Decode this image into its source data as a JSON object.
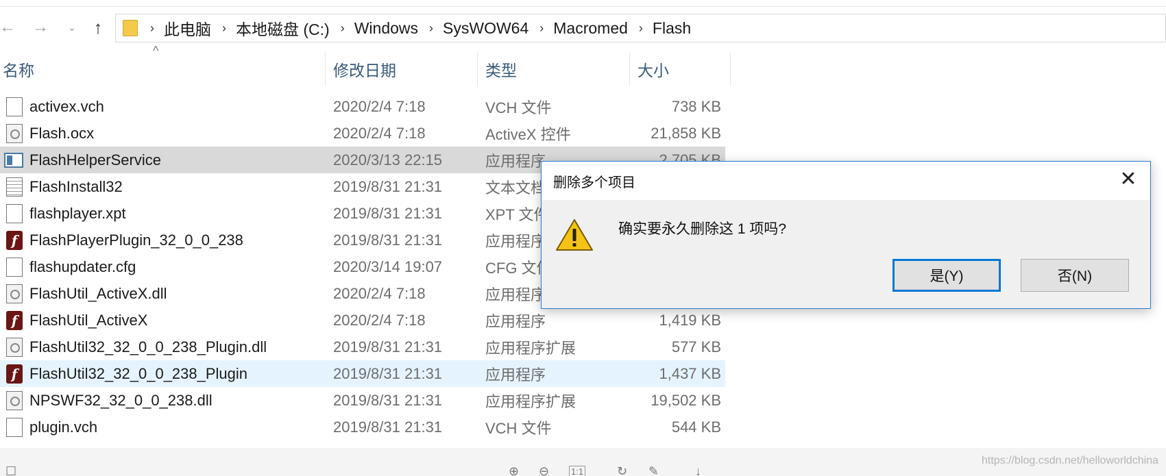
{
  "address_bar": {
    "crumbs": [
      "此电脑",
      "本地磁盘 (C:)",
      "Windows",
      "SysWOW64",
      "Macromed",
      "Flash"
    ]
  },
  "columns": {
    "name": "名称",
    "date": "修改日期",
    "type": "类型",
    "size": "大小"
  },
  "files": [
    {
      "name": "activex.vch",
      "date": "2020/2/4 7:18",
      "type": "VCH 文件",
      "size": "738 KB",
      "icon": "document-icon"
    },
    {
      "name": "Flash.ocx",
      "date": "2020/2/4 7:18",
      "type": "ActiveX 控件",
      "size": "21,858 KB",
      "icon": "activex-icon"
    },
    {
      "name": "FlashHelperService",
      "date": "2020/3/13 22:15",
      "type": "应用程序",
      "size": "2,705 KB",
      "icon": "service-icon"
    },
    {
      "name": "FlashInstall32",
      "date": "2019/8/31 21:31",
      "type": "文本文档",
      "size": "",
      "icon": "text-file-icon"
    },
    {
      "name": "flashplayer.xpt",
      "date": "2019/8/31 21:31",
      "type": "XPT 文件",
      "size": "",
      "icon": "document-icon"
    },
    {
      "name": "FlashPlayerPlugin_32_0_0_238",
      "date": "2019/8/31 21:31",
      "type": "应用程序",
      "size": "",
      "icon": "flash-icon"
    },
    {
      "name": "flashupdater.cfg",
      "date": "2020/3/14 19:07",
      "type": "CFG 文件",
      "size": "",
      "icon": "document-icon"
    },
    {
      "name": "FlashUtil_ActiveX.dll",
      "date": "2020/2/4 7:18",
      "type": "应用程序",
      "size": "",
      "icon": "dll-icon"
    },
    {
      "name": "FlashUtil_ActiveX",
      "date": "2020/2/4 7:18",
      "type": "应用程序",
      "size": "1,419 KB",
      "icon": "flash-icon"
    },
    {
      "name": "FlashUtil32_32_0_0_238_Plugin.dll",
      "date": "2019/8/31 21:31",
      "type": "应用程序扩展",
      "size": "577 KB",
      "icon": "dll-icon"
    },
    {
      "name": "FlashUtil32_32_0_0_238_Plugin",
      "date": "2019/8/31 21:31",
      "type": "应用程序",
      "size": "1,437 KB",
      "icon": "flash-icon"
    },
    {
      "name": "NPSWF32_32_0_0_238.dll",
      "date": "2019/8/31 21:31",
      "type": "应用程序扩展",
      "size": "19,502 KB",
      "icon": "dll-icon"
    },
    {
      "name": "plugin.vch",
      "date": "2019/8/31 21:31",
      "type": "VCH 文件",
      "size": "544 KB",
      "icon": "document-icon"
    }
  ],
  "dialog": {
    "title": "删除多个项目",
    "message": "确实要永久删除这 1 项吗?",
    "yes_label": "是(Y)",
    "no_label": "否(N)"
  },
  "watermark": "https://blog.csdn.net/helloworldchina"
}
